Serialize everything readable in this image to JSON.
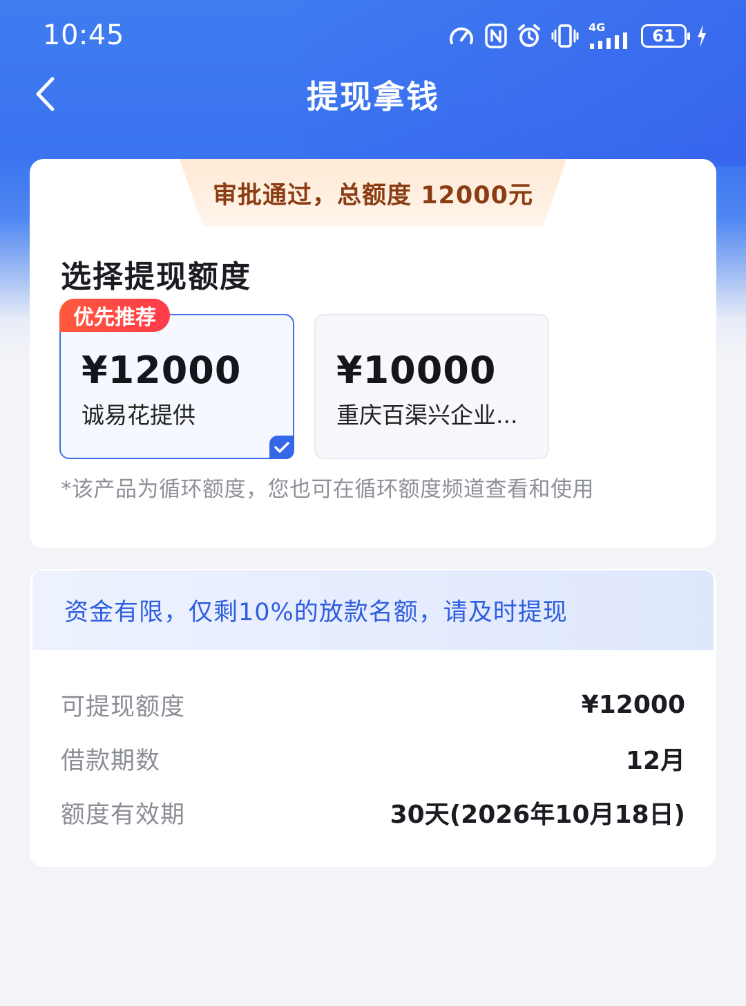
{
  "status_bar": {
    "time": "10:45",
    "network": "4G",
    "battery": "61",
    "icons": [
      "speedometer-icon",
      "nfc-icon",
      "alarm-icon",
      "vibrate-icon",
      "signal-icon",
      "battery-icon",
      "charging-icon"
    ]
  },
  "nav": {
    "title": "提现拿钱",
    "back_icon": "chevron-left-icon"
  },
  "approval": {
    "text": "审批通过，总额度 12000元"
  },
  "selection": {
    "title": "选择提现额度",
    "options": [
      {
        "tag": "优先推荐",
        "amount": "¥12000",
        "provider": "诚易花提供",
        "selected": true
      },
      {
        "tag": "",
        "amount": "¥10000",
        "provider": "重庆百渠兴企业...",
        "selected": false
      }
    ],
    "footnote": "*该产品为循环额度，您也可在循环额度频道查看和使用"
  },
  "notice": {
    "text": "资金有限，仅剩10%的放款名额，请及时提现"
  },
  "details": [
    {
      "label": "可提现额度",
      "value": "¥12000"
    },
    {
      "label": "借款期数",
      "value": "12月"
    },
    {
      "label": "额度有效期",
      "value": "30天(2026年10月18日)"
    }
  ],
  "colors": {
    "primary_blue": "#3a74f0",
    "tag_red": "#ff4a42",
    "approval_text": "#8a3d12",
    "notice_text": "#2f5de0"
  }
}
